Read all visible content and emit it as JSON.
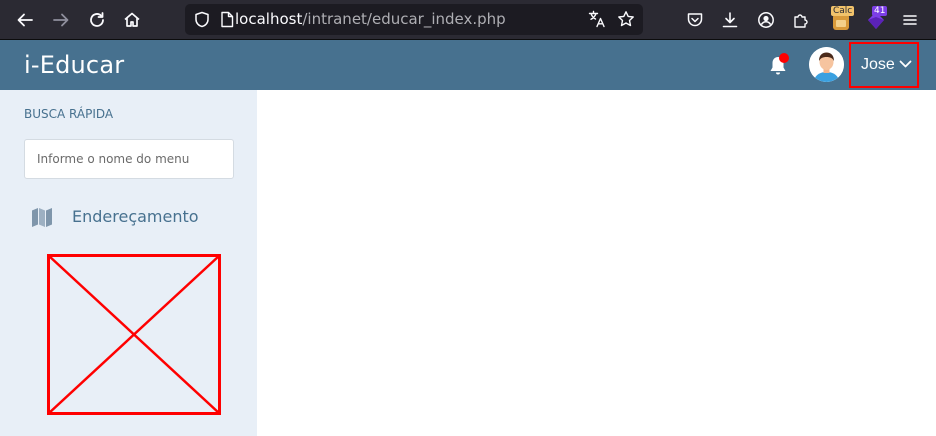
{
  "browser": {
    "url_host": "localhost",
    "url_path": "/intranet/educar_index.php",
    "ext_badge_1": "Calc",
    "ext_badge_2": "41"
  },
  "header": {
    "brand": "i-Educar",
    "user_name": "Jose",
    "accent_color": "#47718f",
    "notification_dot_color": "#ff0000"
  },
  "sidebar": {
    "heading": "BUSCA RÁPIDA",
    "search_placeholder": "Informe o nome do menu",
    "items": [
      {
        "label": "Endereçamento",
        "icon": "map-icon"
      }
    ]
  }
}
